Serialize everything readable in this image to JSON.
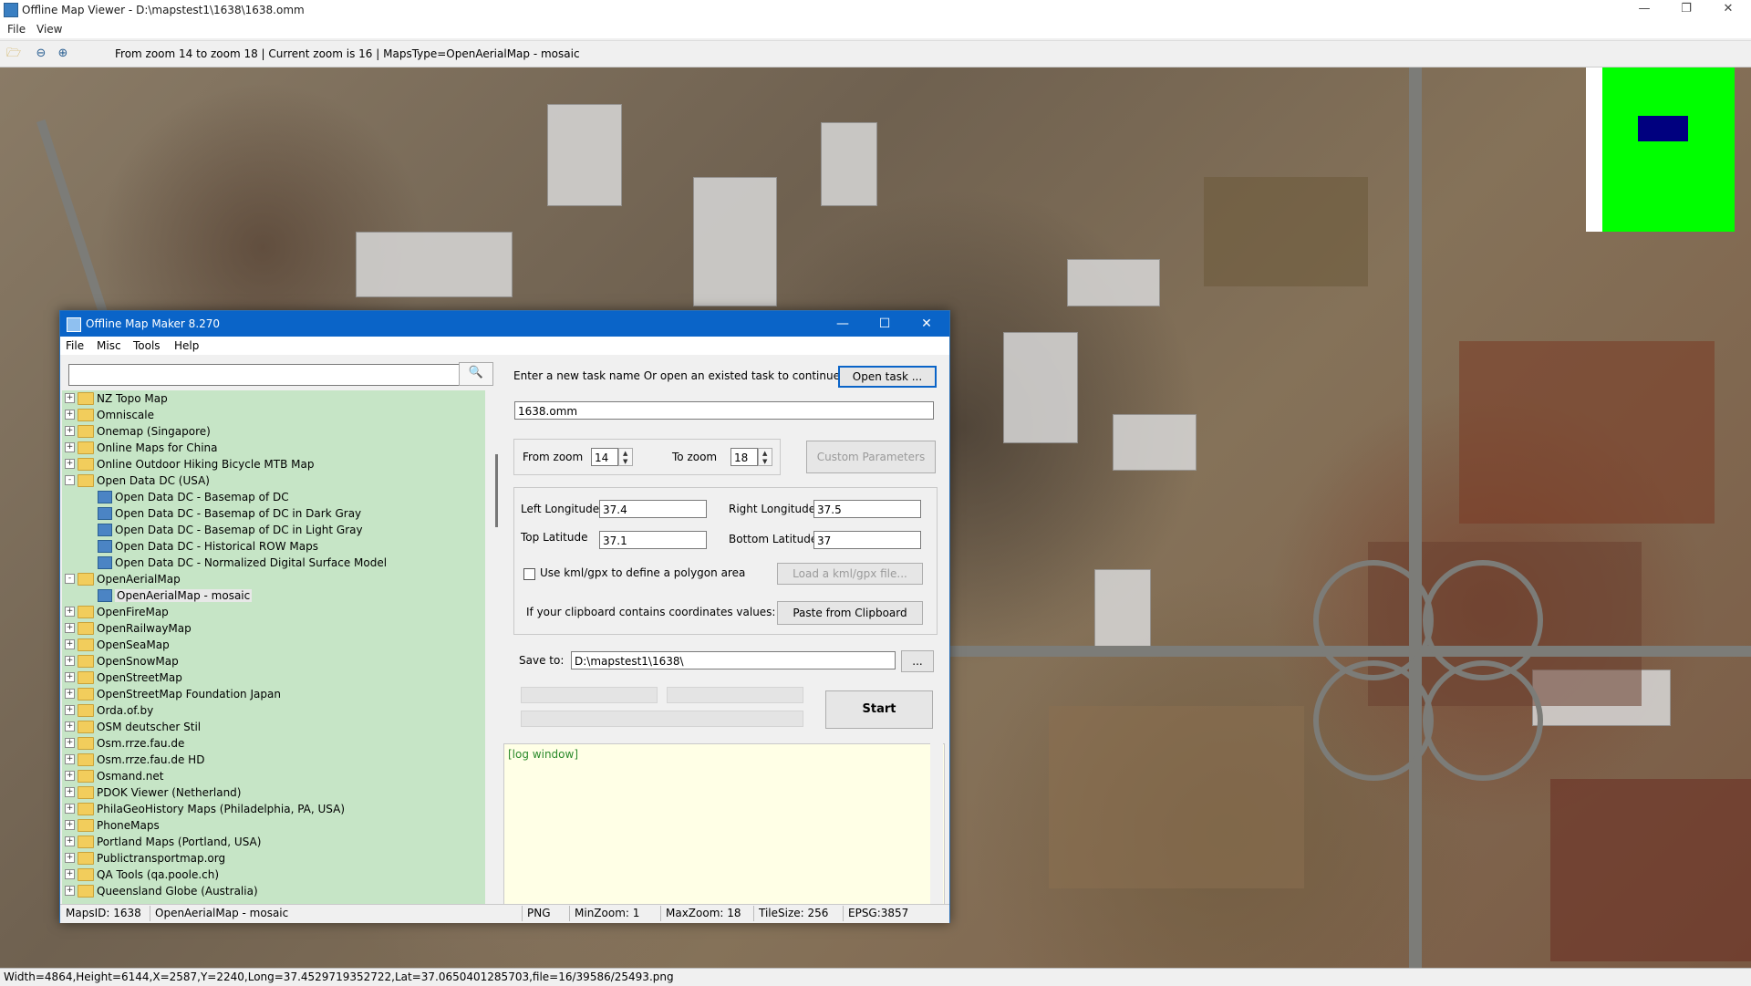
{
  "window": {
    "title": "Offline Map Viewer - D:\\mapstest1\\1638\\1638.omm",
    "min": "—",
    "max": "❐",
    "close": "✕"
  },
  "menu": {
    "file": "File",
    "view": "View"
  },
  "toolbar": {
    "status": "From zoom 14 to zoom 18   |   Current zoom is 16 |   MapsType=OpenAerialMap - mosaic"
  },
  "statusbar": {
    "text": "Width=4864,Height=6144,X=2587,Y=2240,Long=37.4529719352722,Lat=37.0650401285703,file=16/39586/25493.png"
  },
  "minimap": {
    "bg": "#00ff00",
    "view": "#00007f"
  },
  "dialog": {
    "title": "Offline Map Maker 8.270",
    "menu": {
      "file": "File",
      "misc": "Misc",
      "tools": "Tools",
      "help": "Help"
    },
    "search": {
      "value": "",
      "icon": "search-icon"
    },
    "tree": [
      {
        "label": "NZ Topo Map",
        "level": 0,
        "kind": "folder",
        "exp": "+"
      },
      {
        "label": "Omniscale",
        "level": 0,
        "kind": "folder",
        "exp": "+"
      },
      {
        "label": "Onemap (Singapore)",
        "level": 0,
        "kind": "folder",
        "exp": "+"
      },
      {
        "label": "Online Maps for China",
        "level": 0,
        "kind": "folder",
        "exp": "+"
      },
      {
        "label": "Online Outdoor Hiking Bicycle MTB Map",
        "level": 0,
        "kind": "folder",
        "exp": "+"
      },
      {
        "label": "Open Data DC (USA)",
        "level": 0,
        "kind": "folder",
        "exp": "-"
      },
      {
        "label": "Open Data DC - Basemap of DC",
        "level": 1,
        "kind": "map"
      },
      {
        "label": "Open Data DC - Basemap of DC in Dark Gray",
        "level": 1,
        "kind": "map"
      },
      {
        "label": "Open Data DC - Basemap of DC in Light Gray",
        "level": 1,
        "kind": "map"
      },
      {
        "label": "Open Data DC - Historical ROW Maps",
        "level": 1,
        "kind": "map"
      },
      {
        "label": "Open Data DC - Normalized Digital Surface Model",
        "level": 1,
        "kind": "map"
      },
      {
        "label": "OpenAerialMap",
        "level": 0,
        "kind": "folder",
        "exp": "-"
      },
      {
        "label": "OpenAerialMap - mosaic",
        "level": 1,
        "kind": "map",
        "selected": true
      },
      {
        "label": "OpenFireMap",
        "level": 0,
        "kind": "folder",
        "exp": "+"
      },
      {
        "label": "OpenRailwayMap",
        "level": 0,
        "kind": "folder",
        "exp": "+"
      },
      {
        "label": "OpenSeaMap",
        "level": 0,
        "kind": "folder",
        "exp": "+"
      },
      {
        "label": "OpenSnowMap",
        "level": 0,
        "kind": "folder",
        "exp": "+"
      },
      {
        "label": "OpenStreetMap",
        "level": 0,
        "kind": "folder",
        "exp": "+"
      },
      {
        "label": "OpenStreetMap Foundation Japan",
        "level": 0,
        "kind": "folder",
        "exp": "+"
      },
      {
        "label": "Orda.of.by",
        "level": 0,
        "kind": "folder",
        "exp": "+"
      },
      {
        "label": "OSM deutscher Stil",
        "level": 0,
        "kind": "folder",
        "exp": "+"
      },
      {
        "label": "Osm.rrze.fau.de",
        "level": 0,
        "kind": "folder",
        "exp": "+"
      },
      {
        "label": "Osm.rrze.fau.de HD",
        "level": 0,
        "kind": "folder",
        "exp": "+"
      },
      {
        "label": "Osmand.net",
        "level": 0,
        "kind": "folder",
        "exp": "+"
      },
      {
        "label": "PDOK Viewer (Netherland)",
        "level": 0,
        "kind": "folder",
        "exp": "+"
      },
      {
        "label": "PhilaGeoHistory Maps (Philadelphia, PA, USA)",
        "level": 0,
        "kind": "folder",
        "exp": "+"
      },
      {
        "label": "PhoneMaps",
        "level": 0,
        "kind": "folder",
        "exp": "+"
      },
      {
        "label": "Portland Maps (Portland, USA)",
        "level": 0,
        "kind": "folder",
        "exp": "+"
      },
      {
        "label": "Publictransportmap.org",
        "level": 0,
        "kind": "folder",
        "exp": "+"
      },
      {
        "label": "QA Tools (qa.poole.ch)",
        "level": 0,
        "kind": "folder",
        "exp": "+"
      },
      {
        "label": "Queensland Globe (Australia)",
        "level": 0,
        "kind": "folder",
        "exp": "+"
      }
    ],
    "task": {
      "prompt": "Enter a new task name Or open an existed task to continue:",
      "open_btn": "Open task ...",
      "name": "1638.omm"
    },
    "zoom": {
      "from_label": "From zoom",
      "from": "14",
      "to_label": "To zoom",
      "to": "18",
      "custom_btn": "Custom Parameters"
    },
    "coords": {
      "left_lon_label": "Left Longitude",
      "left_lon": "37.4",
      "right_lon_label": "Right Longitude",
      "right_lon": "37.5",
      "top_lat_label": "Top Latitude",
      "top_lat": "37.1",
      "bottom_lat_label": "Bottom Latitude",
      "bottom_lat": "37",
      "kml_label": "Use kml/gpx to define a polygon area",
      "kml_btn": "Load a kml/gpx file...",
      "clip_label": "If your clipboard contains coordinates values:",
      "clip_btn": "Paste from Clipboard"
    },
    "save": {
      "label": "Save to:",
      "path": "D:\\mapstest1\\1638\\",
      "browse": "..."
    },
    "start": "Start",
    "log": "[log window]",
    "status": {
      "mapsid": "MapsID: 1638",
      "name": "OpenAerialMap - mosaic",
      "format": "PNG",
      "minzoom": "MinZoom: 1",
      "maxzoom": "MaxZoom: 18",
      "tilesize": "TileSize: 256",
      "epsg": "EPSG:3857"
    }
  }
}
